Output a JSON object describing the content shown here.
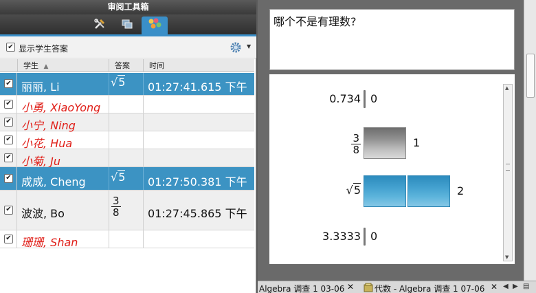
{
  "panel": {
    "title": "审阅工具箱",
    "tabs": [
      {
        "icon": "tools-icon"
      },
      {
        "icon": "screens-icon"
      },
      {
        "icon": "class-icon",
        "active": true
      }
    ],
    "show_answers_label": "显示学生答案",
    "show_answers_checked": true,
    "settings_icon": "gear-icon"
  },
  "table": {
    "headers": {
      "student": "学生",
      "answer": "答案",
      "time": "时间"
    },
    "sort_indicator": "▲",
    "rows": [
      {
        "name": "丽丽, Li",
        "answer_type": "sqrt",
        "answer": "5",
        "time": "01:27:41.615 下午",
        "selected": true,
        "absent": false
      },
      {
        "name": "小勇, XiaoYong",
        "answer_type": "",
        "answer": "",
        "time": "",
        "selected": false,
        "absent": true
      },
      {
        "name": "小宁, Ning",
        "answer_type": "",
        "answer": "",
        "time": "",
        "selected": false,
        "absent": true
      },
      {
        "name": "小花, Hua",
        "answer_type": "",
        "answer": "",
        "time": "",
        "selected": false,
        "absent": true
      },
      {
        "name": "小菊, Ju",
        "answer_type": "",
        "answer": "",
        "time": "",
        "selected": false,
        "absent": true
      },
      {
        "name": "成成, Cheng",
        "answer_type": "sqrt",
        "answer": "5",
        "time": "01:27:50.381 下午",
        "selected": true,
        "absent": false
      },
      {
        "name": "波波, Bo",
        "answer_type": "frac",
        "answer_num": "3",
        "answer_den": "8",
        "time": "01:27:45.865 下午",
        "selected": false,
        "absent": false
      },
      {
        "name": "珊珊, Shan",
        "answer_type": "",
        "answer": "",
        "time": "",
        "selected": false,
        "absent": true
      }
    ]
  },
  "question": {
    "text": "哪个不是有理数?"
  },
  "chart_data": {
    "type": "bar",
    "orientation": "horizontal",
    "categories": [
      "0.734",
      "3/8",
      "√5",
      "3.3333"
    ],
    "values": [
      0,
      1,
      2,
      0
    ],
    "colors": {
      "3/8": "#8f8f8f",
      "√5": "#3a97c8"
    }
  },
  "doc_tabs": [
    {
      "label": "Algebra 调查 1 03-06",
      "close": "✕"
    },
    {
      "label": "代数 - Algebra 调查 1 07-06",
      "close": "✕"
    }
  ]
}
